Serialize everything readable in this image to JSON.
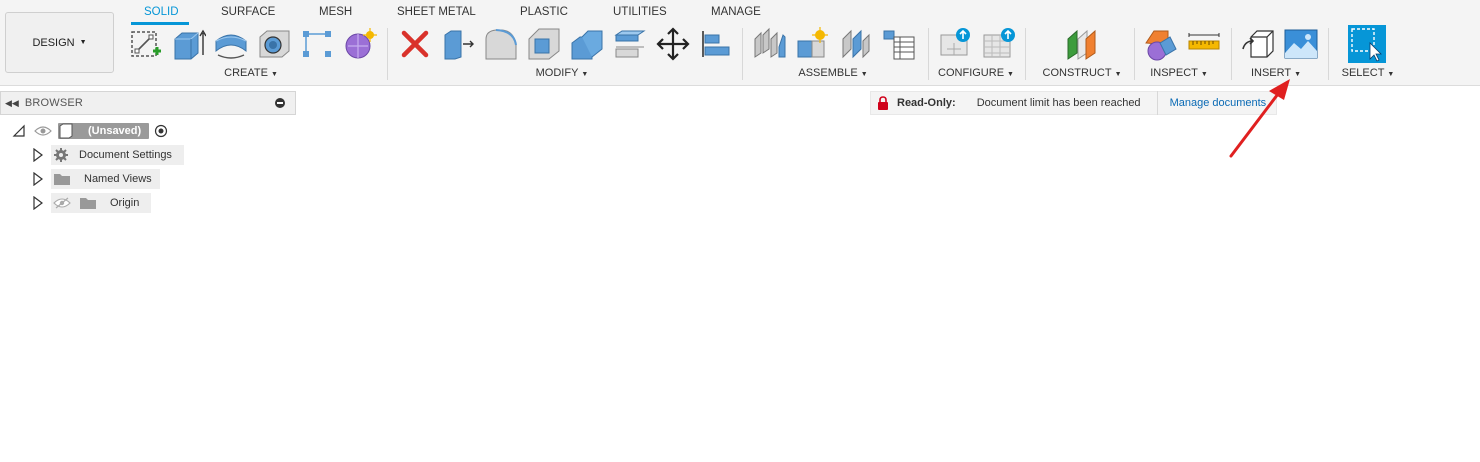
{
  "workspace": {
    "label": "DESIGN"
  },
  "tabs": [
    {
      "label": "SOLID",
      "active": true
    },
    {
      "label": "SURFACE"
    },
    {
      "label": "MESH"
    },
    {
      "label": "SHEET METAL"
    },
    {
      "label": "PLASTIC"
    },
    {
      "label": "UTILITIES"
    },
    {
      "label": "MANAGE"
    }
  ],
  "groups": {
    "create": "CREATE",
    "modify": "MODIFY",
    "assemble": "ASSEMBLE",
    "configure": "CONFIGURE",
    "construct": "CONSTRUCT",
    "inspect": "INSPECT",
    "insert": "INSERT",
    "select": "SELECT"
  },
  "browser": {
    "title": "BROWSER",
    "root": {
      "label": "(Unsaved)"
    },
    "items": [
      {
        "label": "Document Settings"
      },
      {
        "label": "Named Views"
      },
      {
        "label": "Origin"
      }
    ]
  },
  "notice": {
    "prefix": "Read-Only:",
    "message": "Document limit has been reached",
    "link": "Manage documents"
  },
  "colors": {
    "accent": "#0696d7",
    "readonly_red": "#d0021b",
    "annotation_arrow": "#e02020"
  }
}
